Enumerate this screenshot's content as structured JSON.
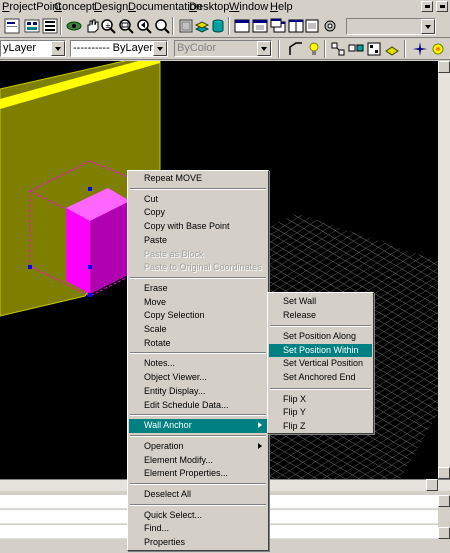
{
  "menubar": {
    "items": [
      "ProjectPoint",
      "Concept",
      "Design",
      "Documentation",
      "Desktop",
      "Window",
      "Help"
    ]
  },
  "toolbar2": {
    "layer_combo": "yLayer",
    "linetype_combo": "---------- ByLayer",
    "color_combo": "ByColor"
  },
  "context_menu": {
    "groups": [
      [
        "Repeat MOVE"
      ],
      [
        "Cut",
        "Copy",
        "Copy with Base Point",
        "Paste",
        "Paste as Block",
        "Paste to Original Coordinates"
      ],
      [
        "Erase",
        "Move",
        "Copy Selection",
        "Scale",
        "Rotate"
      ],
      [
        "Notes...",
        "Object Viewer...",
        "Entity Display...",
        "Edit Schedule Data..."
      ],
      [
        "Wall Anchor"
      ],
      [
        "Operation",
        "Element Modify...",
        "Element Properties..."
      ],
      [
        "Deselect All"
      ],
      [
        "Quick Select...",
        "Find...",
        "Properties"
      ]
    ],
    "disabled": [
      "Paste as Block",
      "Paste to Original Coordinates"
    ],
    "highlighted": "Wall Anchor",
    "submenu_items": [
      "Wall Anchor",
      "Operation"
    ]
  },
  "submenu": {
    "groups": [
      [
        "Set Wall",
        "Release"
      ],
      [
        "Set Position Along",
        "Set Position Within",
        "Set Vertical Position",
        "Set Anchored End"
      ],
      [
        "Flip X",
        "Flip Y",
        "Flip Z"
      ]
    ],
    "highlighted": "Set Position Within"
  },
  "colors": {
    "menu_bg": "#d4d0c8",
    "highlight": "#008080",
    "viewport_bg": "#000000",
    "wall": "#c8c800",
    "object": "#ff00ff",
    "grid": "#9a9a9a"
  },
  "icons": [
    "cmd-icon",
    "properties-icon",
    "grid-icon",
    "zoom-realtime-icon",
    "zoom-window-icon",
    "zoom-previous-icon",
    "pan-icon",
    "layer-icon",
    "database-icon",
    "mdi-icon",
    "window-cascade-icon",
    "window-tile-icon",
    "light-bulb-icon",
    "gear-icon"
  ]
}
